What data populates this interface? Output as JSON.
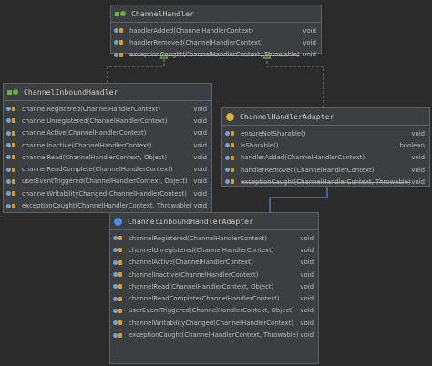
{
  "colors": {
    "background": "#2b2b2b",
    "box": "#3c3f41",
    "border": "#5e6163",
    "text": "#bbbbbb",
    "implements_arrow": "#6fa84f",
    "extends_arrow": "#4b8de0"
  },
  "classes": {
    "channel_handler": {
      "title": "ChannelHandler",
      "icon": "interface-icon",
      "methods": [
        {
          "name": "handlerAdded(ChannelHandlerContext)",
          "type": "void"
        },
        {
          "name": "handlerRemoved(ChannelHandlerContext)",
          "type": "void"
        },
        {
          "name": "exceptionCaught(ChannelHandlerContext, Throwable)",
          "type": "void"
        }
      ]
    },
    "channel_inbound_handler": {
      "title": "ChannelInboundHandler",
      "icon": "interface-icon",
      "methods": [
        {
          "name": "channelRegistered(ChannelHandlerContext)",
          "type": "void"
        },
        {
          "name": "channelUnregistered(ChannelHandlerContext)",
          "type": "void"
        },
        {
          "name": "channelActive(ChannelHandlerContext)",
          "type": "void"
        },
        {
          "name": "channelInactive(ChannelHandlerContext)",
          "type": "void"
        },
        {
          "name": "channelRead(ChannelHandlerContext, Object)",
          "type": "void"
        },
        {
          "name": "channelReadComplete(ChannelHandlerContext)",
          "type": "void"
        },
        {
          "name": "userEventTriggered(ChannelHandlerContext, Object)",
          "type": "void"
        },
        {
          "name": "channelWritabilityChanged(ChannelHandlerContext)",
          "type": "void"
        },
        {
          "name": "exceptionCaught(ChannelHandlerContext, Throwable)",
          "type": "void"
        }
      ]
    },
    "channel_handler_adapter": {
      "title": "ChannelHandlerAdapter",
      "icon": "abstract-class-icon",
      "methods": [
        {
          "name": "ensureNotSharable()",
          "type": "void"
        },
        {
          "name": "isSharable()",
          "type": "boolean"
        },
        {
          "name": "handlerAdded(ChannelHandlerContext)",
          "type": "void"
        },
        {
          "name": "handlerRemoved(ChannelHandlerContext)",
          "type": "void"
        },
        {
          "name": "exceptionCaught(ChannelHandlerContext, Throwable)",
          "type": "void"
        }
      ]
    },
    "channel_inbound_handler_adapter": {
      "title": "ChannelInboundHandlerAdapter",
      "icon": "class-icon",
      "methods": [
        {
          "name": "channelRegistered(ChannelHandlerContext)",
          "type": "void"
        },
        {
          "name": "channelUnregistered(ChannelHandlerContext)",
          "type": "void"
        },
        {
          "name": "channelActive(ChannelHandlerContext)",
          "type": "void"
        },
        {
          "name": "channelInactive(ChannelHandlerContext)",
          "type": "void"
        },
        {
          "name": "channelRead(ChannelHandlerContext, Object)",
          "type": "void"
        },
        {
          "name": "channelReadComplete(ChannelHandlerContext)",
          "type": "void"
        },
        {
          "name": "userEventTriggered(ChannelHandlerContext, Object)",
          "type": "void"
        },
        {
          "name": "channelWritabilityChanged(ChannelHandlerContext)",
          "type": "void"
        },
        {
          "name": "exceptionCaught(ChannelHandlerContext, Throwable)",
          "type": "void"
        }
      ]
    }
  }
}
